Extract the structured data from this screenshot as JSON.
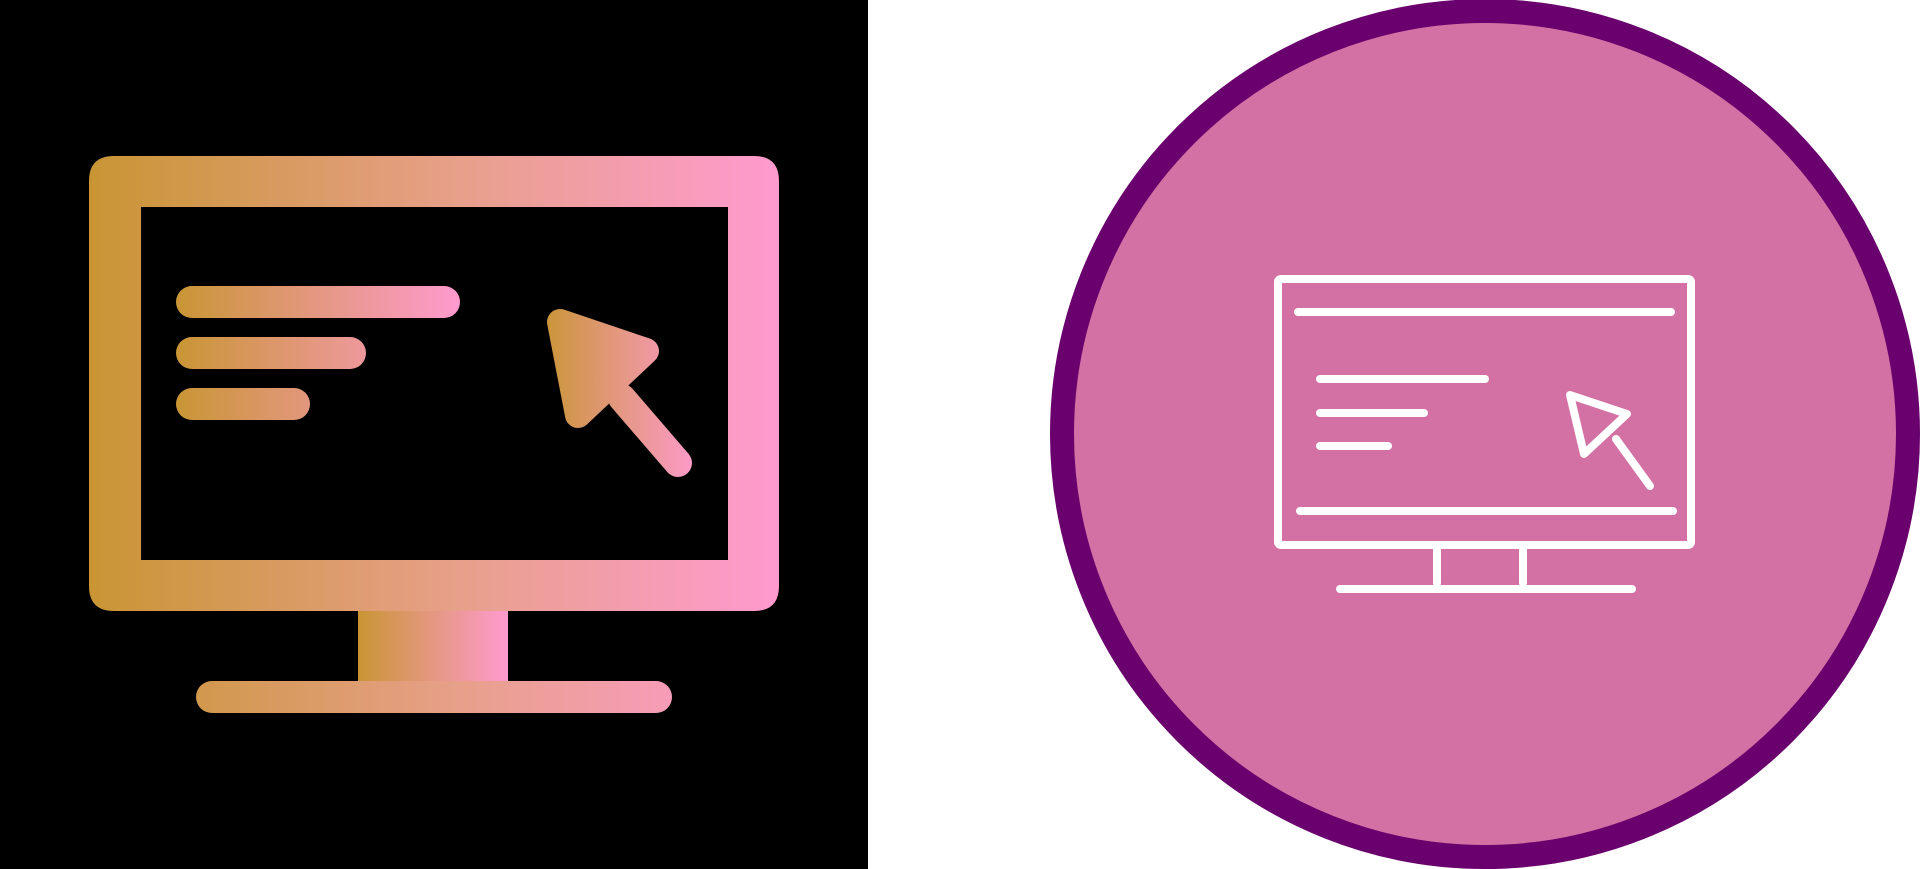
{
  "icons": {
    "gradient_variant": {
      "name": "monitor-cursor-icon",
      "style": "gradient-fill",
      "background": "#000000",
      "gradient_start": "#C99534",
      "gradient_mid": "#E8A08C",
      "gradient_end": "#FF9ACF"
    },
    "circle_variant": {
      "name": "monitor-cursor-icon",
      "style": "white-outline",
      "circle_fill": "#D471A4",
      "circle_stroke": "#6A006D",
      "line_color": "#FFFFFF"
    }
  }
}
